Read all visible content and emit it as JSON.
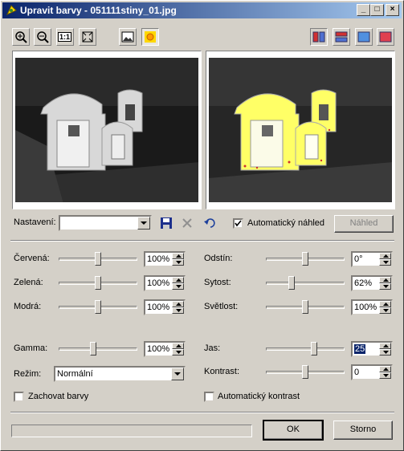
{
  "window": {
    "title": "Upravit barvy - 051111stiny_01.jpg"
  },
  "toolbar": {
    "zoom_in": "zoom-in-icon",
    "zoom_out": "zoom-out-icon",
    "actual_size": "1:1",
    "fit": "fit-to-window-icon"
  },
  "preset": {
    "label": "Nastavení:",
    "value": ""
  },
  "auto_preview": {
    "label": "Automatický náhled",
    "checked": true
  },
  "preview_button": "Náhled",
  "left_sliders": [
    {
      "label": "Červená:",
      "value": "100%",
      "level": 0.5
    },
    {
      "label": "Zelená:",
      "value": "100%",
      "level": 0.5
    },
    {
      "label": "Modrá:",
      "value": "100%",
      "level": 0.5
    },
    {
      "label": "Gamma:",
      "value": "100%",
      "level": 0.43
    }
  ],
  "right_sliders": [
    {
      "label": "Odstín:",
      "value": "0°",
      "level": 0.5
    },
    {
      "label": "Sytost:",
      "value": "62%",
      "level": 0.31
    },
    {
      "label": "Světlost:",
      "value": "100%",
      "level": 0.5
    },
    {
      "label": "Jas:",
      "value": "25",
      "level": 0.62
    },
    {
      "label": "Kontrast:",
      "value": "0",
      "level": 0.5
    }
  ],
  "mode": {
    "label": "Režim:",
    "value": "Normální"
  },
  "keep_colors": {
    "label": "Zachovat barvy",
    "checked": false
  },
  "auto_contrast": {
    "label": "Automatický kontrast",
    "checked": false
  },
  "buttons": {
    "ok": "OK",
    "cancel": "Storno"
  },
  "colors": {
    "title_start": "#0a246a",
    "title_end": "#a6caf0",
    "highlight": "#ffff66"
  }
}
